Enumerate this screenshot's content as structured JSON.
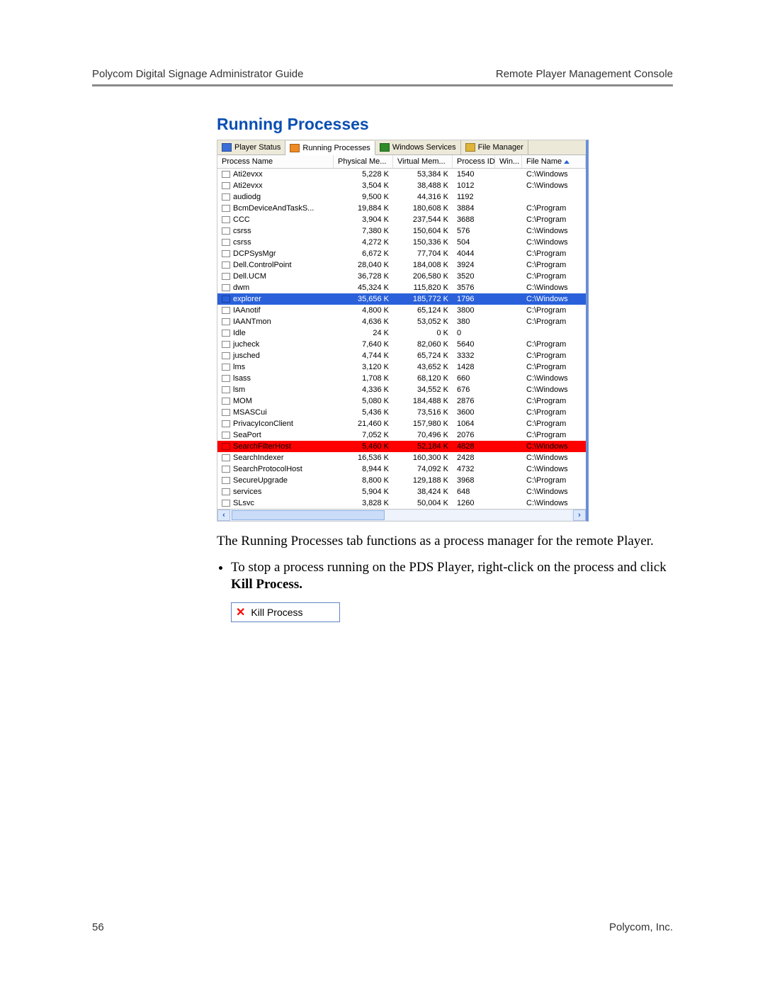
{
  "header": {
    "left": "Polycom Digital Signage Administrator Guide",
    "right": "Remote Player Management Console"
  },
  "footer": {
    "page": "56",
    "company": "Polycom, Inc."
  },
  "section_heading": "Running Processes",
  "tabs": [
    {
      "label": "Player Status",
      "icon_fill": "#3a6fd8"
    },
    {
      "label": "Running Processes",
      "icon_fill": "#f08a24"
    },
    {
      "label": "Windows Services",
      "icon_fill": "#2e8b28"
    },
    {
      "label": "File Manager",
      "icon_fill": "#e0b43a"
    }
  ],
  "active_tab_index": 1,
  "columns": [
    "Process Name",
    "Physical Me...",
    "Virtual Mem...",
    "Process ID",
    "Win...",
    "File Name"
  ],
  "sort_column_index": 5,
  "rows": [
    {
      "name": "Ati2evxx",
      "phys": "5,228 K",
      "virt": "53,384 K",
      "pid": "1540",
      "win": "",
      "file": "C:\\Windows"
    },
    {
      "name": "Ati2evxx",
      "phys": "3,504 K",
      "virt": "38,488 K",
      "pid": "1012",
      "win": "",
      "file": "C:\\Windows"
    },
    {
      "name": "audiodg",
      "phys": "9,500 K",
      "virt": "44,316 K",
      "pid": "1192",
      "win": "",
      "file": ""
    },
    {
      "name": "BcmDeviceAndTaskS...",
      "phys": "19,884 K",
      "virt": "180,608 K",
      "pid": "3884",
      "win": "",
      "file": "C:\\Program"
    },
    {
      "name": "CCC",
      "phys": "3,904 K",
      "virt": "237,544 K",
      "pid": "3688",
      "win": "",
      "file": "C:\\Program"
    },
    {
      "name": "csrss",
      "phys": "7,380 K",
      "virt": "150,604 K",
      "pid": "576",
      "win": "",
      "file": "C:\\Windows"
    },
    {
      "name": "csrss",
      "phys": "4,272 K",
      "virt": "150,336 K",
      "pid": "504",
      "win": "",
      "file": "C:\\Windows"
    },
    {
      "name": "DCPSysMgr",
      "phys": "6,672 K",
      "virt": "77,704 K",
      "pid": "4044",
      "win": "",
      "file": "C:\\Program"
    },
    {
      "name": "Dell.ControlPoint",
      "phys": "28,040 K",
      "virt": "184,008 K",
      "pid": "3924",
      "win": "",
      "file": "C:\\Program"
    },
    {
      "name": "Dell.UCM",
      "phys": "36,728 K",
      "virt": "206,580 K",
      "pid": "3520",
      "win": "",
      "file": "C:\\Program"
    },
    {
      "name": "dwm",
      "phys": "45,324 K",
      "virt": "115,820 K",
      "pid": "3576",
      "win": "",
      "file": "C:\\Windows"
    },
    {
      "name": "explorer",
      "phys": "35,656 K",
      "virt": "185,772 K",
      "pid": "1796",
      "win": "",
      "file": "C:\\Windows",
      "selected": "blue"
    },
    {
      "name": "IAAnotif",
      "phys": "4,800 K",
      "virt": "65,124 K",
      "pid": "3800",
      "win": "",
      "file": "C:\\Program"
    },
    {
      "name": "IAANTmon",
      "phys": "4,636 K",
      "virt": "53,052 K",
      "pid": "380",
      "win": "",
      "file": "C:\\Program"
    },
    {
      "name": "Idle",
      "phys": "24 K",
      "virt": "0 K",
      "pid": "0",
      "win": "",
      "file": ""
    },
    {
      "name": "jucheck",
      "phys": "7,640 K",
      "virt": "82,060 K",
      "pid": "5640",
      "win": "",
      "file": "C:\\Program"
    },
    {
      "name": "jusched",
      "phys": "4,744 K",
      "virt": "65,724 K",
      "pid": "3332",
      "win": "",
      "file": "C:\\Program"
    },
    {
      "name": "lms",
      "phys": "3,120 K",
      "virt": "43,652 K",
      "pid": "1428",
      "win": "",
      "file": "C:\\Program"
    },
    {
      "name": "lsass",
      "phys": "1,708 K",
      "virt": "68,120 K",
      "pid": "660",
      "win": "",
      "file": "C:\\Windows"
    },
    {
      "name": "lsm",
      "phys": "4,336 K",
      "virt": "34,552 K",
      "pid": "676",
      "win": "",
      "file": "C:\\Windows"
    },
    {
      "name": "MOM",
      "phys": "5,080 K",
      "virt": "184,488 K",
      "pid": "2876",
      "win": "",
      "file": "C:\\Program"
    },
    {
      "name": "MSASCui",
      "phys": "5,436 K",
      "virt": "73,516 K",
      "pid": "3600",
      "win": "",
      "file": "C:\\Program"
    },
    {
      "name": "PrivacyIconClient",
      "phys": "21,460 K",
      "virt": "157,980 K",
      "pid": "1064",
      "win": "",
      "file": "C:\\Program"
    },
    {
      "name": "SeaPort",
      "phys": "7,052 K",
      "virt": "70,496 K",
      "pid": "2076",
      "win": "",
      "file": "C:\\Program"
    },
    {
      "name": "SearchFilterHost",
      "phys": "5,460 K",
      "virt": "52,184 K",
      "pid": "4828",
      "win": "",
      "file": "C:\\Windows",
      "selected": "red"
    },
    {
      "name": "SearchIndexer",
      "phys": "16,536 K",
      "virt": "160,300 K",
      "pid": "2428",
      "win": "",
      "file": "C:\\Windows"
    },
    {
      "name": "SearchProtocolHost",
      "phys": "8,944 K",
      "virt": "74,092 K",
      "pid": "4732",
      "win": "",
      "file": "C:\\Windows"
    },
    {
      "name": "SecureUpgrade",
      "phys": "8,800 K",
      "virt": "129,188 K",
      "pid": "3968",
      "win": "",
      "file": "C:\\Program"
    },
    {
      "name": "services",
      "phys": "5,904 K",
      "virt": "38,424 K",
      "pid": "648",
      "win": "",
      "file": "C:\\Windows"
    },
    {
      "name": "SLsvc",
      "phys": "3,828 K",
      "virt": "50,004 K",
      "pid": "1260",
      "win": "",
      "file": "C:\\Windows"
    }
  ],
  "body": {
    "paragraph": "The Running Processes tab functions as a process manager for the remote Player.",
    "bullet_prefix": "To stop a process running on the PDS Player, right-click on the process and click ",
    "bullet_bold": "Kill Process."
  },
  "context_menu": {
    "label": "Kill Process"
  },
  "hscroll": {
    "left_glyph": "‹",
    "right_glyph": "›"
  }
}
